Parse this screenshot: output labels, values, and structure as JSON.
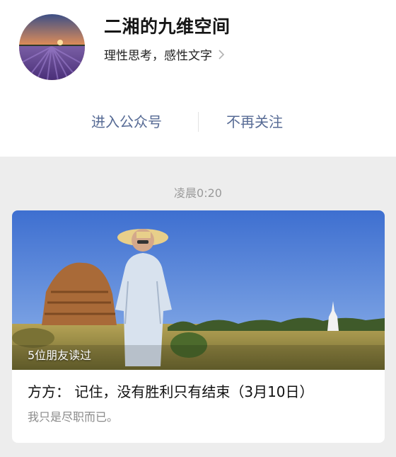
{
  "account": {
    "name": "二湘的九维空间",
    "description": "理性思考，感性文字",
    "avatar_icon": "lavender-field-avatar"
  },
  "actions": {
    "enter_label": "进入公众号",
    "unfollow_label": "不再关注"
  },
  "feed": {
    "timestamp": "凌晨0:20",
    "article": {
      "read_by_friends": "5位朋友读过",
      "title": "方方： 记住，没有胜利只有结束（3月10日）",
      "digest": "我只是尽职而已。"
    }
  },
  "colors": {
    "link": "#576b95",
    "background": "#ededed"
  }
}
